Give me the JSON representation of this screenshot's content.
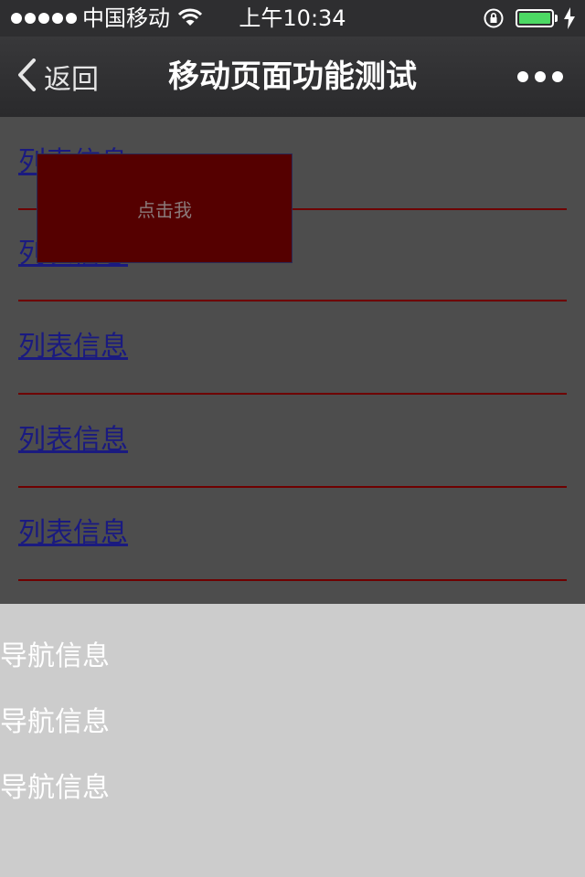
{
  "status_bar": {
    "carrier": "中国移动",
    "time": "上午10:34",
    "battery_level": 1.0,
    "signal_bars": 5
  },
  "nav_bar": {
    "back_label": "返回",
    "title": "移动页面功能测试"
  },
  "list": {
    "items": [
      {
        "label": "列表信息"
      },
      {
        "label": "列表信息"
      },
      {
        "label": "列表信息"
      },
      {
        "label": "列表信息"
      },
      {
        "label": "列表信息"
      }
    ]
  },
  "popup": {
    "button_label": "点击我"
  },
  "bottom_nav": {
    "items": [
      {
        "label": "导航信息"
      },
      {
        "label": "导航信息"
      },
      {
        "label": "导航信息"
      }
    ]
  },
  "colors": {
    "list_divider": "#6e0000",
    "popup_bg": "#550000",
    "link": "#1a1a80",
    "battery": "#4cd964"
  }
}
